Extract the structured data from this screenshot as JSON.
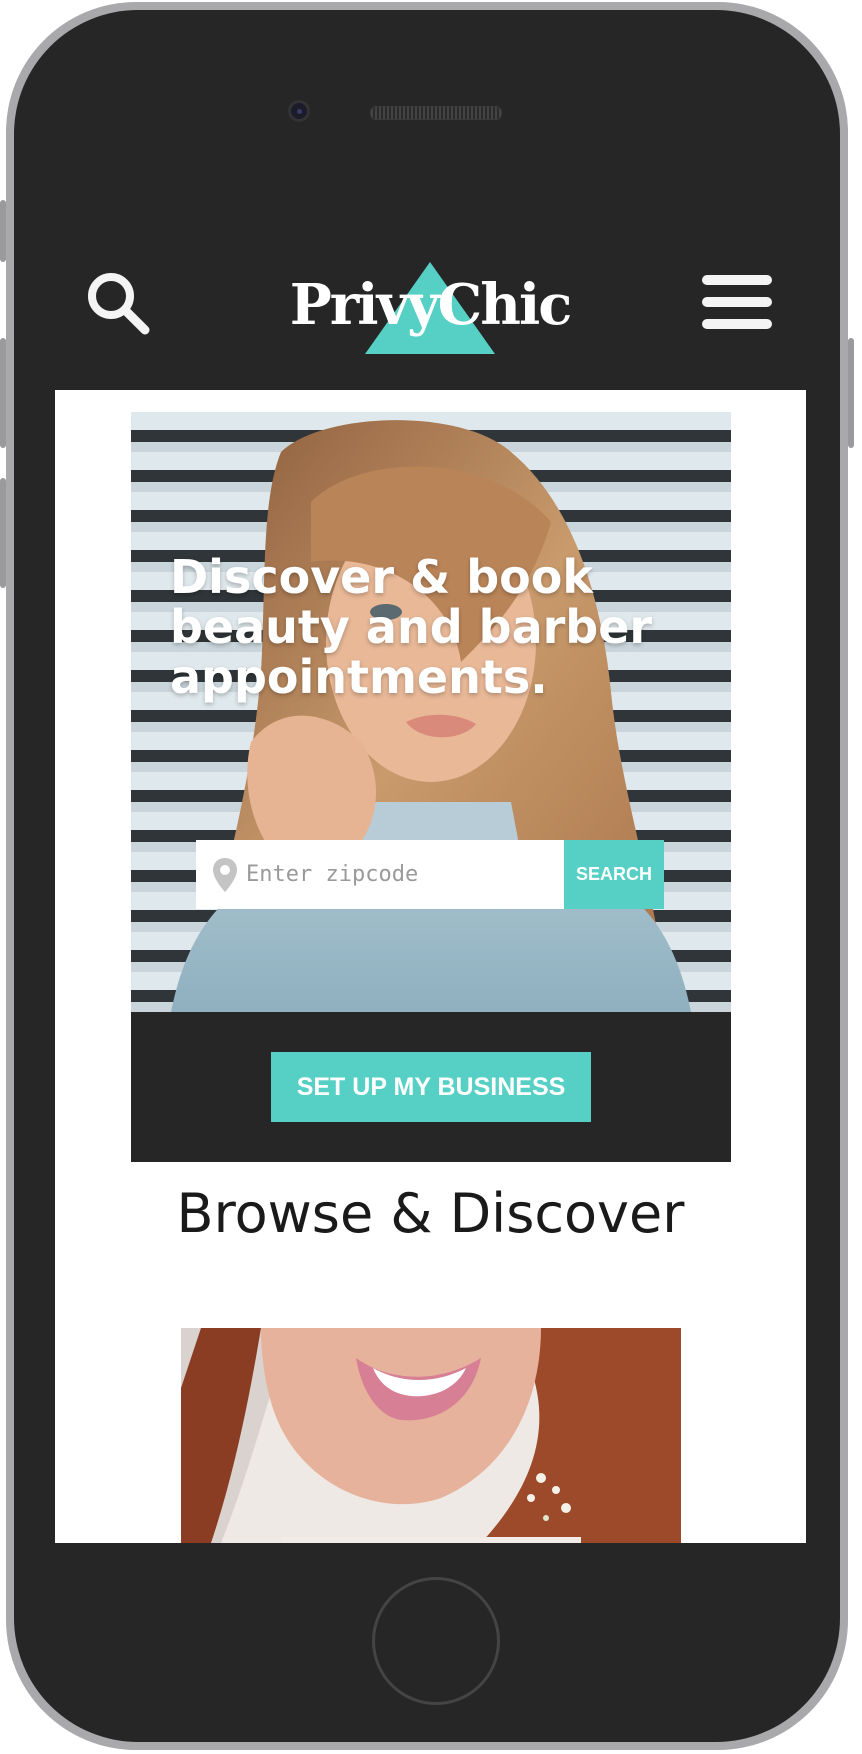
{
  "header": {
    "logo_text": "PrivyChic",
    "search_icon": "search-icon",
    "menu_icon": "hamburger-menu-icon"
  },
  "hero": {
    "headline": "Discover & book beauty and barber appointments.",
    "zip_placeholder": "Enter zipcode",
    "zip_value": "",
    "search_label": "SEARCH",
    "pin_icon": "location-pin-icon"
  },
  "business": {
    "button_label": "SET UP MY BUSINESS"
  },
  "browse": {
    "title": "Browse & Discover"
  },
  "colors": {
    "accent": "#56cfc4",
    "dark": "#262626",
    "white": "#ffffff"
  }
}
